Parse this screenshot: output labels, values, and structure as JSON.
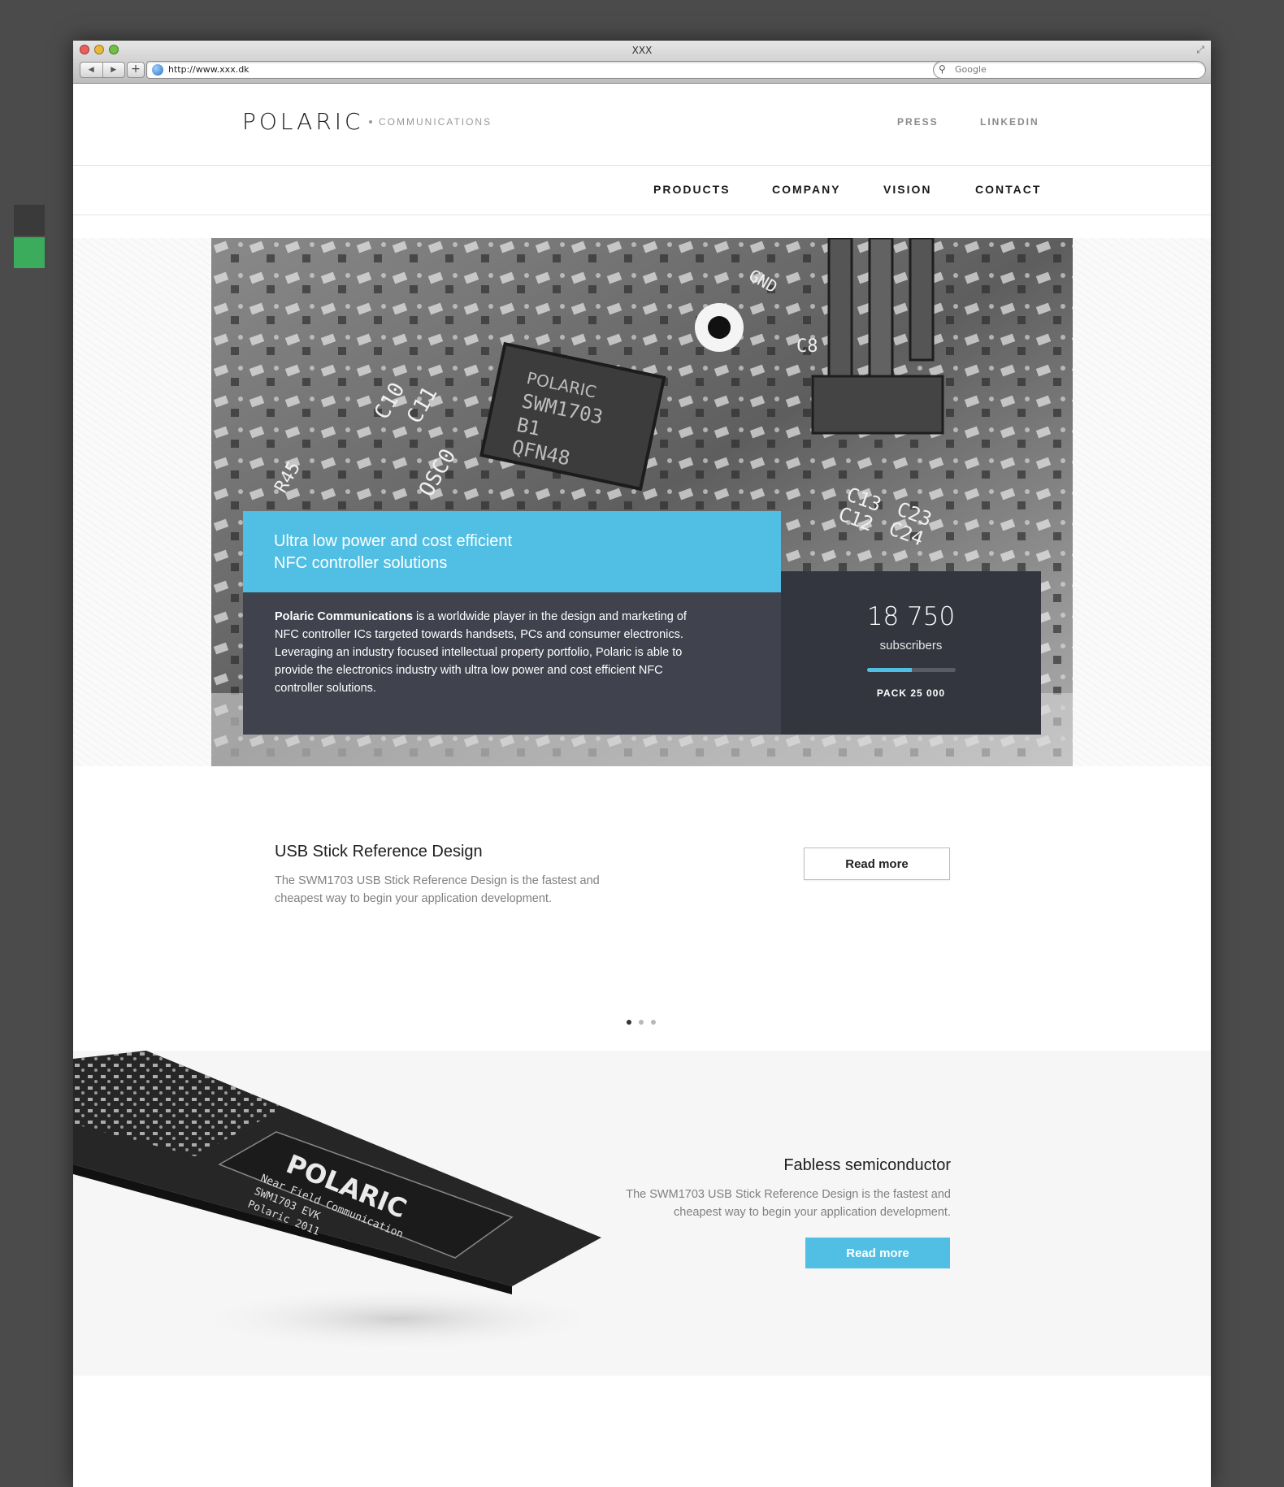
{
  "browser": {
    "window_title": "XXX",
    "url": "http://www.xxx.dk",
    "search_placeholder": "Google"
  },
  "brand": {
    "logo": "POLARIC",
    "subtitle": "COMMUNICATIONS"
  },
  "top_links": [
    "PRESS",
    "LINKEDIN"
  ],
  "main_nav": [
    "PRODUCTS",
    "COMPANY",
    "VISION",
    "CONTACT"
  ],
  "hero": {
    "tagline_line1": "Ultra low power and cost efficient",
    "tagline_line2": "NFC controller solutions",
    "about_strong": "Polaric Communications",
    "about_text": " is a worldwide player in the design and marketing of NFC controller ICs targeted towards handsets, PCs and consumer electronics. Leveraging an industry focused intellectual property portfolio, Polaric is able to provide the electronics industry with ultra low power and cost efficient NFC controller solutions.",
    "chip_labels": [
      "POLARIC",
      "SWM1703",
      "B1",
      "QFN48"
    ],
    "board_labels": [
      "C10",
      "C11",
      "OSC0",
      "R45",
      "C8",
      "C13",
      "C23",
      "C12",
      "C24",
      "GND"
    ],
    "stat_value": "18 750",
    "stat_label": "subscribers",
    "stat_progress": 0.5,
    "stat_pack": "PACK 25 000"
  },
  "feature": {
    "title": "USB Stick Reference Design",
    "description": "The SWM1703 USB Stick Reference Design is the fastest and cheapest way to begin your application development.",
    "button": "Read more"
  },
  "carousel": {
    "count": 3,
    "active": 0
  },
  "section2": {
    "title": "Fabless semiconductor",
    "description": "The SWM1703 USB Stick Reference Design is the fastest and cheapest way to begin your application development.",
    "button": "Read more",
    "board_logo": "POLARIC",
    "board_lines": [
      "Near Field Communication",
      "SWM1703 EVK",
      "Polaric 2011"
    ]
  },
  "colors": {
    "accent": "#51bfe3",
    "panel_dark": "#40424d",
    "panel_darker": "#34363f",
    "desktop_bg": "#4b4b4b",
    "swatch_dark": "#3a3a3a",
    "swatch_green": "#3bab5c"
  },
  "icons": [
    "back-arrow-icon",
    "forward-arrow-icon",
    "plus-icon",
    "globe-icon",
    "reload-icon",
    "search-icon",
    "resize-icon"
  ]
}
